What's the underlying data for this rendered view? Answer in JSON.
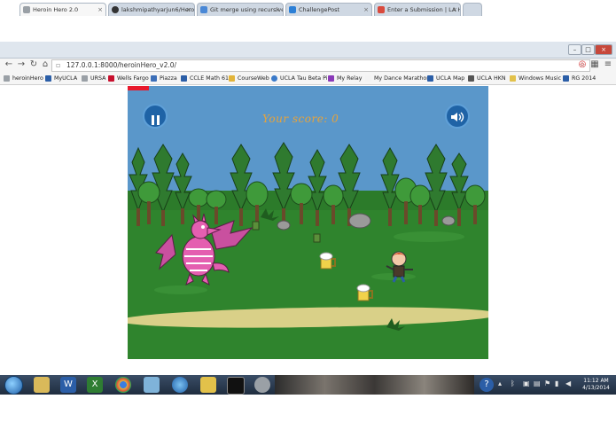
{
  "browser": {
    "tabs": [
      {
        "label": "Heroin Hero 2.0",
        "active": true,
        "color": "#9aa0a6"
      },
      {
        "label": "lakshmipathyarjun6/Hero",
        "active": false,
        "color": "#333333"
      },
      {
        "label": "Git merge using recursive",
        "active": false,
        "color": "#4a88d6"
      },
      {
        "label": "ChallengePost",
        "active": false,
        "color": "#2c7fd6"
      },
      {
        "label": "Enter a Submission | LA H",
        "active": false,
        "color": "#d94a3d"
      }
    ],
    "url": "127.0.0.1:8000/heroinHero_v2.0/",
    "bookmarks": [
      {
        "label": "heroinHero",
        "color": "#9aa0a6"
      },
      {
        "label": "MyUCLA",
        "color": "#2b5ea7"
      },
      {
        "label": "URSA",
        "color": "#9aa0a6"
      },
      {
        "label": "Wells Fargo",
        "color": "#c8102e"
      },
      {
        "label": "Piazza",
        "color": "#3d6fb8"
      },
      {
        "label": "CCLE Math 61",
        "color": "#2b5ea7"
      },
      {
        "label": "CourseWeb",
        "color": "#e2b43a"
      },
      {
        "label": "UCLA Tau Beta Pi",
        "color": "#3a7ac9"
      },
      {
        "label": "My Relay",
        "color": "#8a3ab9"
      },
      {
        "label": "My Dance Marathon",
        "color": "#f3f3f3"
      },
      {
        "label": "UCLA Map",
        "color": "#2b5ea7"
      },
      {
        "label": "UCLA HKN",
        "color": "#555555"
      },
      {
        "label": "Windows Music",
        "color": "#e2c14a"
      },
      {
        "label": "RG 2014",
        "color": "#2b5ea7"
      }
    ]
  },
  "game": {
    "score_label": "Your score: 0",
    "progress_fraction": 0.06,
    "pause_icon": "pause-icon",
    "sound_icon": "speaker-icon"
  },
  "taskbar": {
    "time": "11:12 AM",
    "date": "4/13/2014"
  },
  "colors": {
    "sky": "#5a97ca",
    "grass": "#2f842d",
    "path": "#d9d088",
    "score": "#e8a33a",
    "dragon": "#e45fb0"
  }
}
